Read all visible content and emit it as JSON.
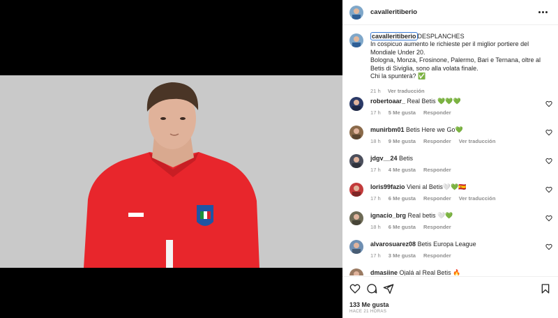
{
  "post": {
    "username": "cavalleritiberio",
    "more_label": "More options"
  },
  "caption": {
    "username": "cavalleritiberio",
    "line1": "DESPLANCHES",
    "line2": "In cospicuo aumento le richieste per il miglior portiere del",
    "line3": "Mondiale Under 20.",
    "line4": "Bologna, Monza, Frosinone, Palermo, Bari e Ternana, oltre al",
    "line5": "Betis di Siviglia, sono alla volata finale.",
    "line6": "Chi la spunterà? ✅",
    "time": "21 h",
    "translate": "Ver traducción"
  },
  "comments": [
    {
      "username": "robertoaar_",
      "text": "Real Betis 💚💚💚",
      "time": "17 h",
      "likes": "5 Me gusta",
      "reply": "Responder",
      "translate": "",
      "avatar_color": "#2b3a67"
    },
    {
      "username": "munirbm01",
      "text": "Betis Here we Go💚",
      "time": "18 h",
      "likes": "9 Me gusta",
      "reply": "Responder",
      "translate": "Ver traducción",
      "avatar_color": "#8a6a4a"
    },
    {
      "username": "jdgv__24",
      "text": "Betis",
      "time": "17 h",
      "likes": "4 Me gusta",
      "reply": "Responder",
      "translate": "",
      "avatar_color": "#4b4f5c"
    },
    {
      "username": "loris99fazio",
      "text": "Vieni al Betis🤍💚🇪🇸",
      "time": "17 h",
      "likes": "6 Me gusta",
      "reply": "Responder",
      "translate": "Ver traducción",
      "avatar_color": "#c23b3b"
    },
    {
      "username": "ignacio_brg",
      "text": "Real betis 🤍💚",
      "time": "18 h",
      "likes": "6 Me gusta",
      "reply": "Responder",
      "translate": "",
      "avatar_color": "#6d6a55"
    },
    {
      "username": "alvarosuarez08",
      "text": "Betis Europa League",
      "time": "17 h",
      "likes": "3 Me gusta",
      "reply": "Responder",
      "translate": "",
      "avatar_color": "#6f8fb2"
    },
    {
      "username": "dmasiine",
      "text": "Ojalá al Real Betis 🔥",
      "time": "",
      "likes": "",
      "reply": "",
      "translate": "",
      "avatar_color": "#9a7a62"
    }
  ],
  "footer": {
    "likes": "133 Me gusta",
    "ago": "HACE 21 HORAS"
  },
  "icons": {
    "like": "heart-icon",
    "comment": "comment-icon",
    "share": "share-icon",
    "save": "bookmark-icon"
  },
  "colors": {
    "shirt": "#e8262c",
    "background_photo": "#c8c8c8",
    "text": "#262626",
    "muted": "#8e8e8e"
  }
}
